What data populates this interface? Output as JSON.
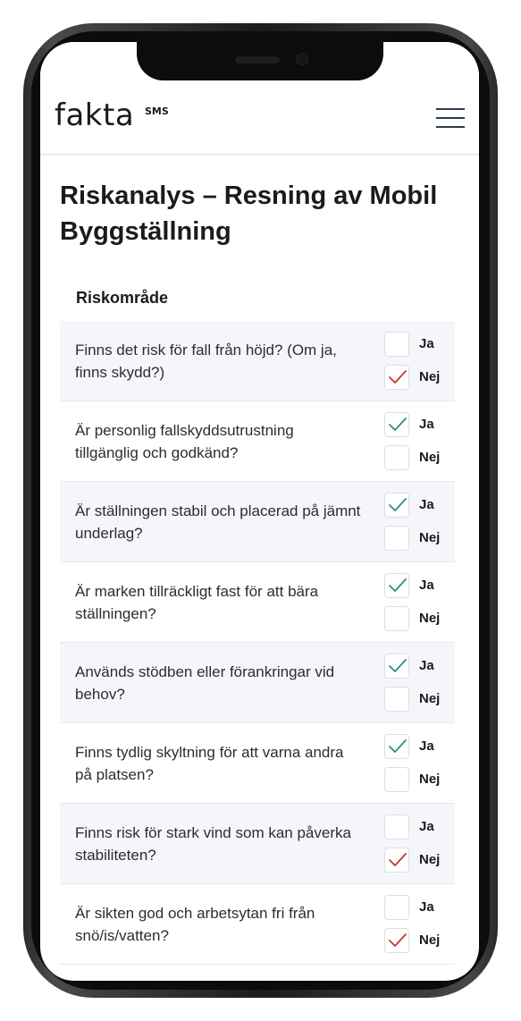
{
  "app": {
    "logo": "fakta",
    "logo_sup": "SMS",
    "menu_icon": "hamburger-menu-icon"
  },
  "page": {
    "title": "Riskanalys – Resning av Mobil Byggställning",
    "section_label": "Riskområde"
  },
  "options": {
    "yes": "Ja",
    "no": "Nej"
  },
  "colors": {
    "check_yes": "#2f8f86",
    "check_no": "#c0392b",
    "row_shade": "#f4f6f9",
    "menu": "#2d3a4f"
  },
  "items": [
    {
      "question": "Finns det risk för fall från höjd? (Om ja, finns skydd?)",
      "answer": "Nej"
    },
    {
      "question": "Är personlig fallskyddsutrustning tillgänglig och godkänd?",
      "answer": "Ja"
    },
    {
      "question": "Är ställningen stabil och placerad på jämnt underlag?",
      "answer": "Ja"
    },
    {
      "question": "Är marken tillräckligt fast för att bära ställningen?",
      "answer": "Ja"
    },
    {
      "question": "Används stödben eller förankringar vid behov?",
      "answer": "Ja"
    },
    {
      "question": "Finns tydlig skyltning för att varna andra på platsen?",
      "answer": "Ja"
    },
    {
      "question": "Finns risk för stark vind som kan påverka stabiliteten?",
      "answer": "Nej"
    },
    {
      "question": "Är sikten god och arbetsytan fri från snö/is/vatten?",
      "answer": "Nej"
    }
  ]
}
